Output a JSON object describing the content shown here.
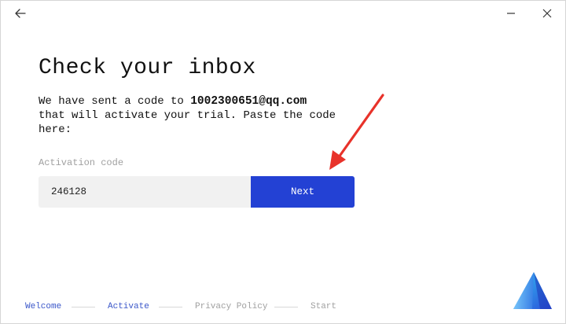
{
  "window": {
    "controls": {
      "back_icon": "arrow-left-icon",
      "minimize_icon": "minimize-icon",
      "close_icon": "close-icon"
    }
  },
  "page": {
    "title": "Check your inbox",
    "message_prefix": "We have sent a code to ",
    "email": "1002300651@qq.com",
    "message_suffix": " that will activate your trial. Paste the code here:"
  },
  "form": {
    "label": "Activation code",
    "code_value": "246128",
    "next_label": "Next"
  },
  "annotation": {
    "color": "#e8322a"
  },
  "steps": {
    "items": [
      {
        "label": "Welcome",
        "state": "done"
      },
      {
        "label": "Activate",
        "state": "current"
      },
      {
        "label": "Privacy Policy",
        "state": "upcoming"
      },
      {
        "label": "Start",
        "state": "upcoming"
      }
    ]
  },
  "colors": {
    "accent": "#2341d4",
    "step_active": "#3b57c9",
    "step_inactive": "#a0a0a0",
    "input_bg": "#f1f1f1"
  },
  "logo_icon": "app-triangle-logo-icon"
}
